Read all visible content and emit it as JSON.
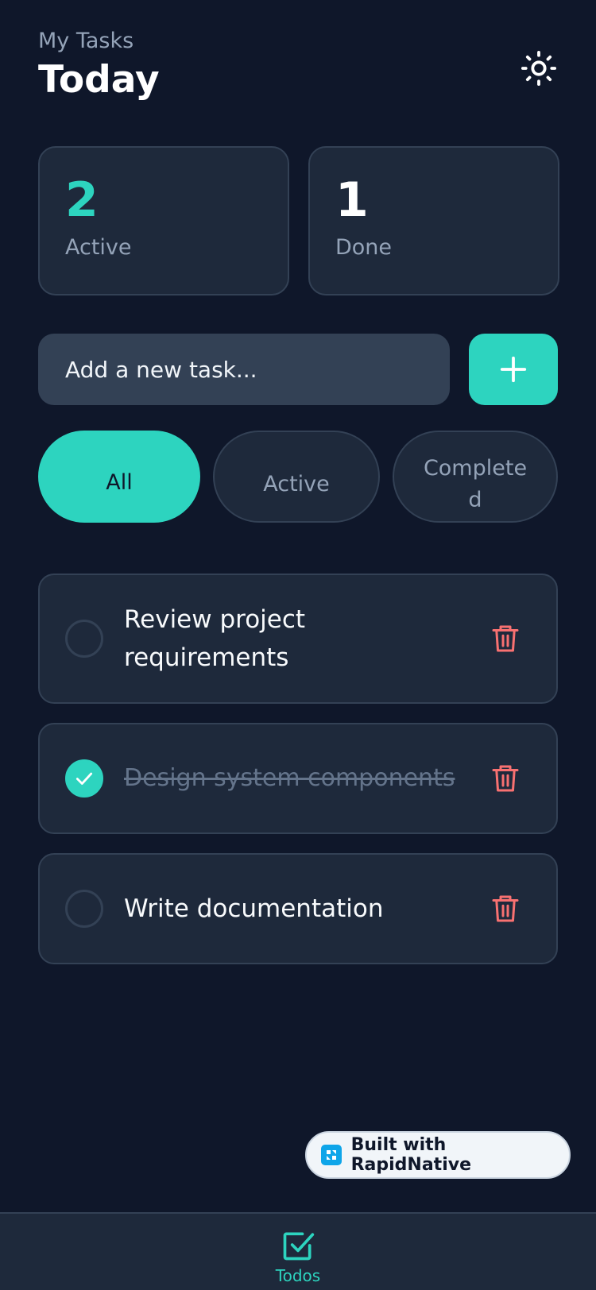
{
  "header": {
    "subtitle": "My Tasks",
    "title": "Today",
    "theme_icon": "sun-icon"
  },
  "stats": {
    "active": {
      "value": "2",
      "label": "Active",
      "color": "#2dd4bf"
    },
    "done": {
      "value": "1",
      "label": "Done",
      "color": "#ffffff"
    }
  },
  "composer": {
    "placeholder": "Add a new task...",
    "value": "",
    "add_icon": "plus-icon"
  },
  "filters": [
    {
      "label": "All",
      "selected": true
    },
    {
      "label": "Active",
      "selected": false
    },
    {
      "label": "Completed",
      "selected": false
    }
  ],
  "todos": [
    {
      "text": "Review project requirements",
      "completed": false
    },
    {
      "text": "Design system components",
      "completed": true
    },
    {
      "text": "Write documentation",
      "completed": false
    }
  ],
  "badge": {
    "label": "Built with RapidNative"
  },
  "tabbar": {
    "items": [
      {
        "label": "Todos",
        "icon": "checkbox-icon",
        "active": true
      }
    ]
  },
  "colors": {
    "background": "#0f172a",
    "card": "#1e293b",
    "accent": "#2dd4bf",
    "danger": "#f87171"
  }
}
